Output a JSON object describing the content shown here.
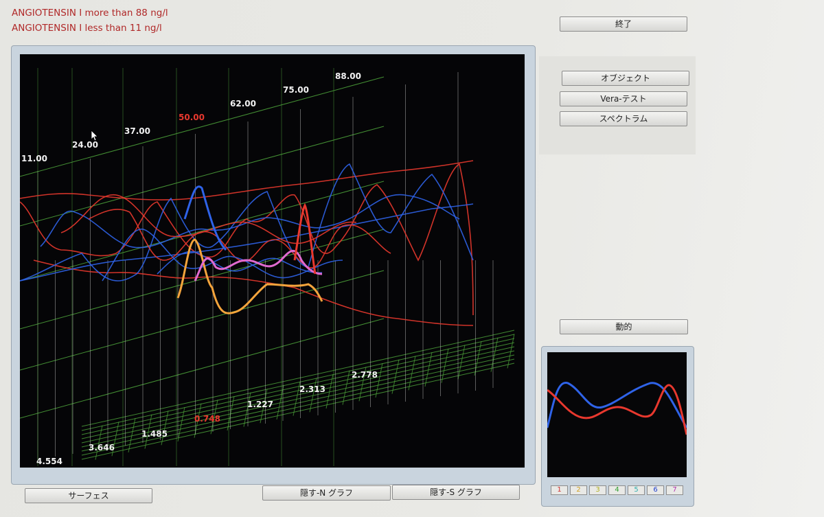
{
  "header": {
    "line_more": "ANGIOTENSIN I more than 88 ng/l",
    "line_less": "ANGIOTENSIN I less than 11 ng/l"
  },
  "buttons": {
    "exit": "終了",
    "object": "オブジェクト",
    "vera_test": "Vera-テスト",
    "spectrum": "スペクトラム",
    "dynamic": "動的",
    "surface": "サーフェス",
    "hide_n_graph": "隠す-N グラフ",
    "hide_s_graph": "隠す-S グラフ"
  },
  "chart_data": {
    "type": "line",
    "top_axis_labels": [
      "11.00",
      "24.00",
      "37.00",
      "50.00",
      "62.00",
      "75.00",
      "88.00"
    ],
    "top_axis_highlight": "50.00",
    "bottom_axis_labels": [
      "4.554",
      "3.646",
      "1.485",
      "0.748",
      "1.227",
      "2.313",
      "2.778"
    ],
    "bottom_axis_highlight": "0.748",
    "series_colors": {
      "blue": "#2f63e8",
      "red": "#e8382e",
      "orange": "#f4a43c",
      "pink": "#e06ad0",
      "grid": "#4fa83c"
    }
  },
  "mini_chart": {
    "series_colors": {
      "blue": "#2f63e8",
      "red": "#e8382e"
    }
  },
  "swatches": [
    {
      "label": "1",
      "color": "#d03030"
    },
    {
      "label": "2",
      "color": "#d0a020"
    },
    {
      "label": "3",
      "color": "#b0b020"
    },
    {
      "label": "4",
      "color": "#30a030"
    },
    {
      "label": "5",
      "color": "#30b0b0"
    },
    {
      "label": "6",
      "color": "#2040d0"
    },
    {
      "label": "7",
      "color": "#b030b0"
    }
  ]
}
